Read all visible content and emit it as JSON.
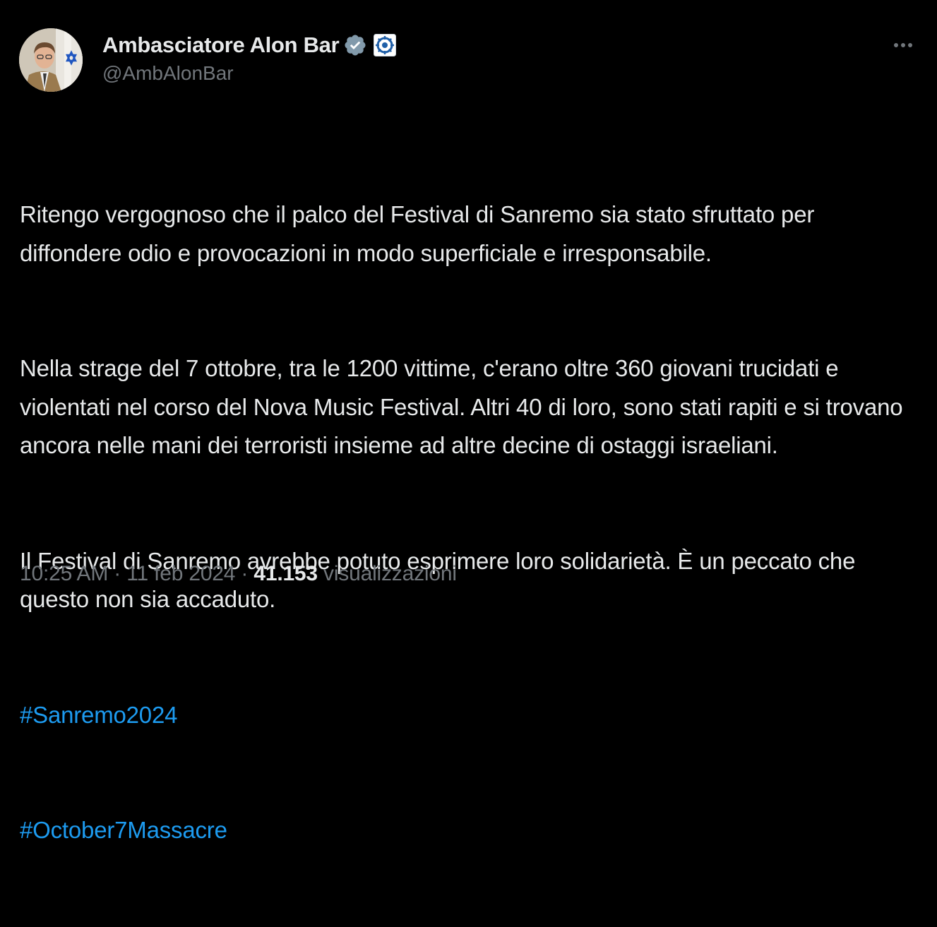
{
  "author": {
    "display_name": "Ambasciatore Alon Bar",
    "handle": "@AmbAlonBar",
    "verified_badge_icon": "verified-badge-icon",
    "affiliate_badge_icon": "affiliate-badge-icon",
    "avatar_icon": "avatar"
  },
  "tweet": {
    "paragraphs": [
      "Ritengo vergognoso che il palco del Festival di Sanremo sia stato sfruttato per diffondere odio e provocazioni in modo superficiale e irresponsabile.",
      "Nella strage del 7 ottobre, tra le 1200 vittime, c'erano oltre 360 giovani trucidati e violentati nel corso del Nova Music Festival. Altri 40 di loro, sono stati rapiti e si trovano ancora nelle mani dei terroristi insieme ad altre decine di ostaggi israeliani.",
      "Il Festival di Sanremo avrebbe potuto esprimere loro solidarietà. È un peccato che questo non sia accaduto."
    ],
    "hashtags": [
      "#Sanremo2024",
      "#October7Massacre"
    ]
  },
  "meta": {
    "time": "10:25 AM",
    "separator": " · ",
    "date": "11 feb 2024",
    "views_count": "41.153",
    "views_label": "visualizzazioni"
  },
  "colors": {
    "background": "#000000",
    "text": "#e7e9ea",
    "secondary": "#71767b",
    "link": "#1d9bf0"
  }
}
